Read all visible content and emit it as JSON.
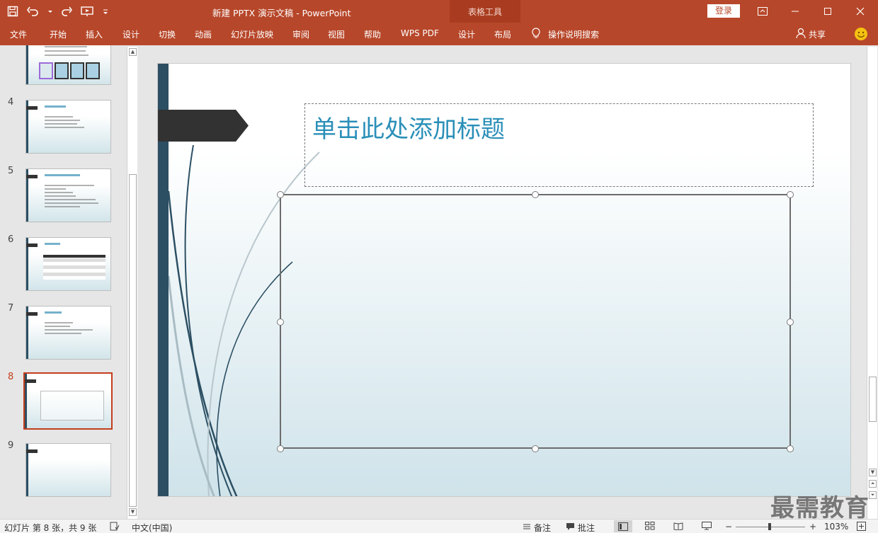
{
  "window": {
    "doc_title": "新建 PPTX 演示文稿  -  PowerPoint",
    "context_tab_title": "表格工具",
    "login_label": "登录"
  },
  "ribbon": {
    "tabs": [
      "文件",
      "开始",
      "插入",
      "设计",
      "切换",
      "动画",
      "幻灯片放映",
      "审阅",
      "视图",
      "帮助",
      "WPS PDF",
      "设计",
      "布局"
    ],
    "tell_me": "操作说明搜索",
    "share": "共享"
  },
  "thumbnails": {
    "numbers": [
      "4",
      "5",
      "6",
      "7",
      "8",
      "9"
    ],
    "active": "8"
  },
  "slide": {
    "title_placeholder": "单击此处添加标题"
  },
  "watermark": "最需教育",
  "status": {
    "slide_info": "幻灯片 第 8 张，共 9 张",
    "language": "中文(中国)",
    "notes": "备注",
    "comments": "批注",
    "zoom_minus": "−",
    "zoom_plus": "+",
    "zoom": "103%"
  },
  "colors": {
    "accent": "#b7472a",
    "title_text": "#2a8fb8",
    "slide_bar": "#2c4f63"
  }
}
